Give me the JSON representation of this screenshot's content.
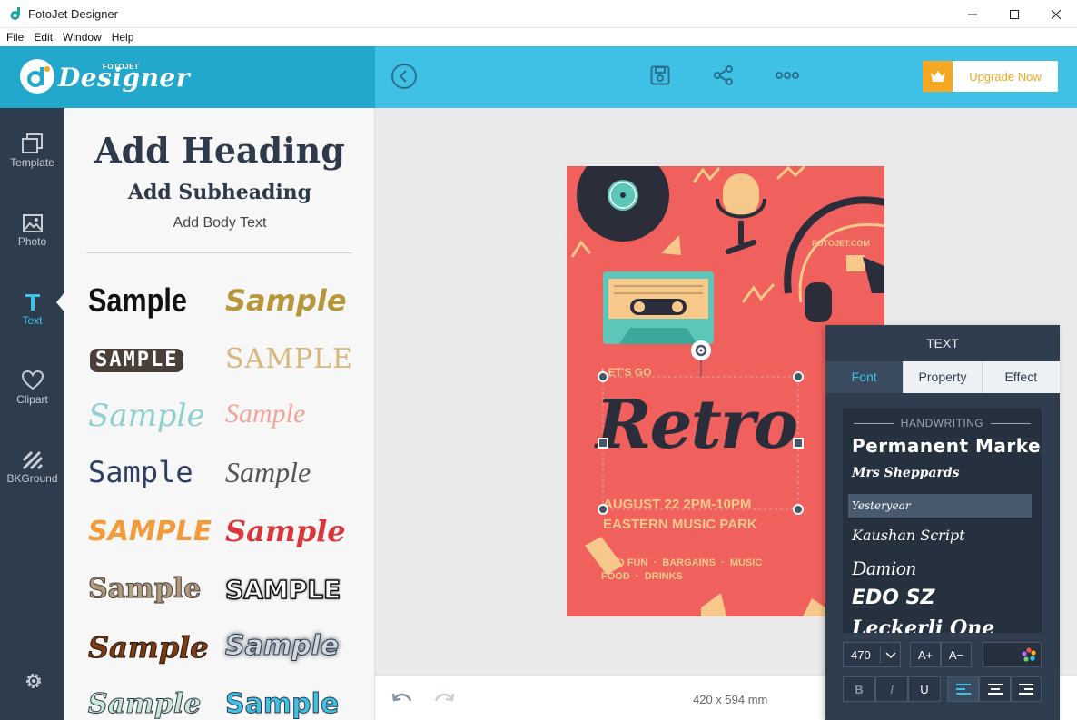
{
  "window": {
    "title": "FotoJet Designer"
  },
  "menu": [
    "File",
    "Edit",
    "Window",
    "Help"
  ],
  "header": {
    "logo_small": "FOTOJET",
    "logo_text": "Designer",
    "upgrade_label": "Upgrade Now"
  },
  "nav": [
    {
      "label": "Template",
      "icon": "template-icon"
    },
    {
      "label": "Photo",
      "icon": "photo-icon"
    },
    {
      "label": "Text",
      "icon": "text-icon",
      "active": true
    },
    {
      "label": "Clipart",
      "icon": "heart-icon"
    },
    {
      "label": "BKGround",
      "icon": "background-icon"
    }
  ],
  "text_panel": {
    "heading": "Add Heading",
    "subheading": "Add Subheading",
    "body": "Add Body Text",
    "samples": [
      "Sample",
      "Sample",
      "SAMPLE",
      "SAMPLE",
      "Sample",
      "Sample",
      "Sample",
      "Sample",
      "SAMPLE",
      "Sample",
      "Sample",
      "SAMPLE",
      "Sample",
      "Sample",
      "Sample",
      "Sample"
    ]
  },
  "poster": {
    "site": "FOTOJET.COM",
    "lets_go": "LET'S GO",
    "title": "Retro",
    "date_line": "AUGUST 22  2PM-10PM",
    "venue_line": "EASTERN MUSIC PARK",
    "tag1": "FIND FUN",
    "tag2": "BARGAINS",
    "tag3": "MUSIC",
    "tag4": "FOOD",
    "tag5": "DRINKS",
    "dot": "·"
  },
  "footer": {
    "dimensions": "420 x 594 mm"
  },
  "text_props": {
    "title": "TEXT",
    "tabs": [
      "Font",
      "Property",
      "Effect"
    ],
    "category": "HANDWRITING",
    "fonts": [
      "Permanent Marker",
      "Mrs Sheppards",
      "Yesteryear",
      "Kaushan Script",
      "Damion",
      "EDO SZ",
      "Leckerli One"
    ],
    "font_size": "470",
    "increase": "A+",
    "decrease": "A−",
    "bold": "B",
    "italic": "I",
    "underline": "U"
  },
  "colors": {
    "header_main": "#3fc1e5",
    "header_logo": "#22a8cc",
    "nav_bg": "#2e3d4e",
    "poster_bg": "#f0605d",
    "accent_orange": "#f5a623"
  }
}
